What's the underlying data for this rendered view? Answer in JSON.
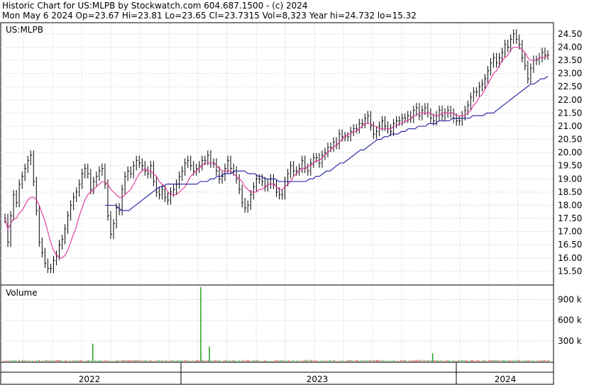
{
  "header": {
    "line1": "Historic Chart for US:MLPB by Stockwatch.com 604.687.1500 - (c) 2024",
    "line2": "Mon May  6 2024   Op=23.67  Hi=23.81  Lo=23.65  Cl=23.7315  Vol=8,323  Year hi=24.732  lo=15.32"
  },
  "chart_data": [
    {
      "type": "line",
      "title": "US:MLPB",
      "ylim": [
        15.0,
        24.9
      ],
      "yticks": [
        "24.50",
        "24.00",
        "23.50",
        "23.00",
        "22.50",
        "22.00",
        "21.50",
        "21.00",
        "20.50",
        "20.00",
        "19.50",
        "19.00",
        "18.50",
        "18.00",
        "17.50",
        "17.00",
        "16.50",
        "16.00",
        "15.50"
      ],
      "x_labels": [
        "2022",
        "2023",
        "2024"
      ],
      "grid": true,
      "series": [
        {
          "role": "price",
          "color": "#000000",
          "values": [
            17.5,
            16.6,
            17.6,
            18.4,
            18.1,
            18.8,
            19.1,
            19.4,
            19.7,
            19.9,
            18.9,
            17.8,
            16.6,
            16.2,
            15.8,
            15.6,
            15.6,
            15.9,
            16.1,
            16.5,
            16.7,
            17.1,
            17.6,
            18.0,
            18.3,
            18.5,
            18.8,
            19.2,
            19.4,
            19.2,
            18.6,
            18.9,
            19.1,
            19.3,
            19.4,
            18.8,
            17.6,
            16.9,
            17.3,
            17.9,
            17.8,
            18.6,
            19.1,
            19.3,
            19.2,
            19.5,
            19.7,
            19.6,
            19.5,
            19.3,
            19.2,
            19.5,
            18.9,
            18.5,
            18.4,
            18.6,
            18.3,
            18.2,
            18.5,
            18.6,
            18.8,
            19.1,
            19.3,
            19.6,
            19.7,
            19.5,
            19.3,
            19.4,
            19.5,
            19.7,
            19.7,
            19.9,
            19.6,
            19.6,
            19.3,
            19.0,
            19.1,
            19.4,
            19.7,
            19.4,
            19.3,
            19.0,
            18.6,
            18.1,
            17.9,
            18.0,
            18.4,
            18.7,
            19.0,
            19.0,
            18.9,
            18.7,
            18.8,
            19.0,
            18.8,
            18.5,
            18.4,
            18.4,
            18.9,
            19.2,
            19.5,
            19.3,
            19.3,
            19.4,
            19.7,
            19.4,
            19.3,
            19.6,
            19.8,
            19.8,
            19.6,
            19.9,
            20.0,
            20.2,
            20.2,
            20.4,
            20.3,
            20.7,
            20.6,
            20.6,
            20.6,
            20.8,
            20.9,
            20.9,
            21.1,
            21.1,
            21.3,
            21.4,
            21.0,
            20.7,
            20.8,
            21.0,
            21.2,
            21.0,
            20.9,
            20.8,
            21.1,
            21.2,
            21.2,
            21.3,
            21.3,
            21.4,
            21.3,
            21.6,
            21.7,
            21.4,
            21.6,
            21.7,
            21.5,
            21.3,
            21.2,
            21.4,
            21.6,
            21.4,
            21.5,
            21.6,
            21.5,
            21.3,
            21.2,
            21.2,
            21.4,
            21.6,
            21.8,
            22.1,
            22.3,
            22.3,
            22.5,
            22.6,
            22.8,
            23.1,
            23.4,
            23.6,
            23.4,
            23.6,
            23.8,
            24.1,
            24.0,
            24.3,
            24.5,
            24.3,
            24.1,
            23.6,
            23.3,
            22.8,
            23.2,
            23.5,
            23.5,
            23.6,
            23.8,
            23.7,
            23.7
          ]
        },
        {
          "role": "moving-average-short",
          "color": "#e0309a",
          "values": [
            17.5,
            17.1,
            17.3,
            17.5,
            17.5,
            17.7,
            17.8,
            18.0,
            18.2,
            18.3,
            18.3,
            18.2,
            18.0,
            17.7,
            17.4,
            17.0,
            16.6,
            16.3,
            16.1,
            16.0,
            16.0,
            16.1,
            16.3,
            16.6,
            16.9,
            17.2,
            17.6,
            17.9,
            18.2,
            18.4,
            18.5,
            18.6,
            18.7,
            18.8,
            18.9,
            18.9,
            18.8,
            18.6,
            18.5,
            18.4,
            18.3,
            18.3,
            18.4,
            18.5,
            18.6,
            18.8,
            19.0,
            19.2,
            19.3,
            19.4,
            19.3,
            19.3,
            19.2,
            19.1,
            18.9,
            18.8,
            18.7,
            18.5,
            18.4,
            18.4,
            18.4,
            18.5,
            18.6,
            18.7,
            18.9,
            19.1,
            19.2,
            19.3,
            19.4,
            19.5,
            19.6,
            19.6,
            19.6,
            19.6,
            19.5,
            19.4,
            19.3,
            19.3,
            19.3,
            19.3,
            19.2,
            19.1,
            19.0,
            18.9,
            18.7,
            18.6,
            18.5,
            18.5,
            18.5,
            18.6,
            18.6,
            18.7,
            18.8,
            18.8,
            18.8,
            18.7,
            18.6,
            18.6,
            18.7,
            18.8,
            18.9,
            19.1,
            19.2,
            19.3,
            19.4,
            19.4,
            19.5,
            19.5,
            19.6,
            19.7,
            19.7,
            19.8,
            19.9,
            20.0,
            20.1,
            20.2,
            20.3,
            20.4,
            20.5,
            20.6,
            20.7,
            20.7,
            20.8,
            20.8,
            20.9,
            21.0,
            21.1,
            21.1,
            21.1,
            21.0,
            21.0,
            20.9,
            20.9,
            20.9,
            20.9,
            20.9,
            21.0,
            21.0,
            21.1,
            21.1,
            21.2,
            21.2,
            21.3,
            21.4,
            21.4,
            21.5,
            21.5,
            21.5,
            21.5,
            21.5,
            21.4,
            21.4,
            21.4,
            21.5,
            21.5,
            21.5,
            21.5,
            21.5,
            21.4,
            21.4,
            21.4,
            21.4,
            21.5,
            21.6,
            21.8,
            21.9,
            22.1,
            22.2,
            22.4,
            22.6,
            22.8,
            23.0,
            23.1,
            23.3,
            23.5,
            23.6,
            23.7,
            23.9,
            24.0,
            24.0,
            24.0,
            23.9,
            23.8,
            23.6,
            23.5,
            23.5,
            23.5,
            23.6,
            23.6,
            23.6,
            23.7
          ]
        },
        {
          "role": "moving-average-long",
          "color": "#1a1aa0",
          "start_index": 35,
          "values": [
            18.0,
            18.0,
            18.0,
            18.0,
            17.9,
            17.8,
            17.8,
            17.8,
            17.9,
            18.0,
            18.1,
            18.2,
            18.3,
            18.4,
            18.5,
            18.6,
            18.7,
            18.7,
            18.8,
            18.8,
            18.8,
            18.8,
            18.8,
            18.8,
            18.8,
            18.8,
            18.8,
            18.8,
            18.9,
            18.9,
            18.9,
            19.0,
            19.0,
            19.1,
            19.1,
            19.2,
            19.2,
            19.2,
            19.3,
            19.3,
            19.3,
            19.3,
            19.2,
            19.2,
            19.2,
            19.1,
            19.1,
            19.0,
            19.0,
            19.0,
            19.0,
            18.9,
            18.9,
            18.9,
            18.9,
            18.9,
            18.9,
            18.9,
            18.9,
            18.9,
            19.0,
            19.0,
            19.1,
            19.1,
            19.2,
            19.3,
            19.3,
            19.4,
            19.5,
            19.6,
            19.6,
            19.7,
            19.8,
            19.9,
            20.0,
            20.1,
            20.1,
            20.2,
            20.3,
            20.4,
            20.5,
            20.5,
            20.6,
            20.6,
            20.7,
            20.7,
            20.7,
            20.8,
            20.8,
            20.9,
            20.9,
            20.9,
            21.0,
            21.0,
            21.0,
            21.1,
            21.1,
            21.1,
            21.2,
            21.2,
            21.2,
            21.2,
            21.3,
            21.3,
            21.3,
            21.3,
            21.3,
            21.3,
            21.4,
            21.4,
            21.4,
            21.4,
            21.5,
            21.5,
            21.5,
            21.6,
            21.7,
            21.8,
            21.9,
            22.0,
            22.1,
            22.2,
            22.3,
            22.4,
            22.5,
            22.6,
            22.6,
            22.7,
            22.8,
            22.8,
            22.9
          ]
        }
      ]
    },
    {
      "type": "bar",
      "title": "Volume",
      "ylim": [
        0,
        1100000
      ],
      "yticks": [
        "900 k",
        "600 k",
        "300 k"
      ],
      "spikes": [
        {
          "index": 62,
          "value": 260000,
          "color": "#20a020"
        },
        {
          "index": 137,
          "value": 1080000,
          "color": "#20a020"
        },
        {
          "index": 143,
          "value": 220000,
          "color": "#20a020"
        },
        {
          "index": 298,
          "value": 120000,
          "color": "#20a020"
        }
      ]
    }
  ]
}
